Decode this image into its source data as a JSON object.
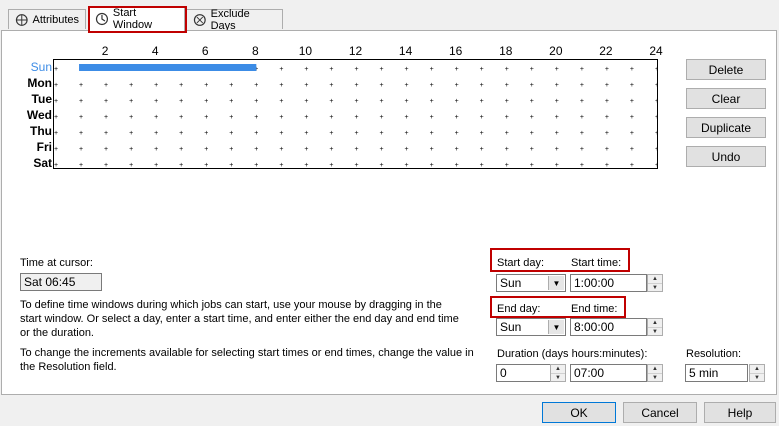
{
  "tabs": [
    {
      "label": "Attributes",
      "icon": "attributes-icon"
    },
    {
      "label": "Start Window",
      "icon": "start-window-icon"
    },
    {
      "label": "Exclude Days",
      "icon": "exclude-days-icon"
    }
  ],
  "schedule": {
    "hour_labels": [
      "2",
      "4",
      "6",
      "8",
      "10",
      "12",
      "14",
      "16",
      "18",
      "20",
      "22",
      "24"
    ],
    "days": [
      "Sun",
      "Mon",
      "Tue",
      "Wed",
      "Thu",
      "Fri",
      "Sat"
    ],
    "selected_day": "Sun",
    "window": {
      "day": "Sun",
      "start_hour": 1.0,
      "end_hour": 8.0
    },
    "highlight_color": "#3c8ce6"
  },
  "side_buttons": {
    "delete": "Delete",
    "clear": "Clear",
    "duplicate": "Duplicate",
    "undo": "Undo"
  },
  "cursor": {
    "label": "Time at cursor:",
    "value": "Sat 06:45"
  },
  "help": {
    "define": "To define time windows during which jobs can start, use your mouse by dragging in the start window.  Or select a day, enter a start time, and enter either the end day and end time or the duration.",
    "increments": "To change the increments available for selecting start times or end times, change the value in the Resolution field."
  },
  "start": {
    "day_label": "Start day:",
    "time_label": "Start time:",
    "day_value": "Sun",
    "time_value": "1:00:00"
  },
  "end": {
    "day_label": "End day:",
    "time_label": "End time:",
    "day_value": "Sun",
    "time_value": "8:00:00"
  },
  "duration": {
    "label": "Duration (days hours:minutes):",
    "days_value": "0",
    "time_value": "07:00"
  },
  "resolution": {
    "label": "Resolution:",
    "value": "5 min"
  },
  "footer": {
    "ok": "OK",
    "cancel": "Cancel",
    "help": "Help"
  }
}
